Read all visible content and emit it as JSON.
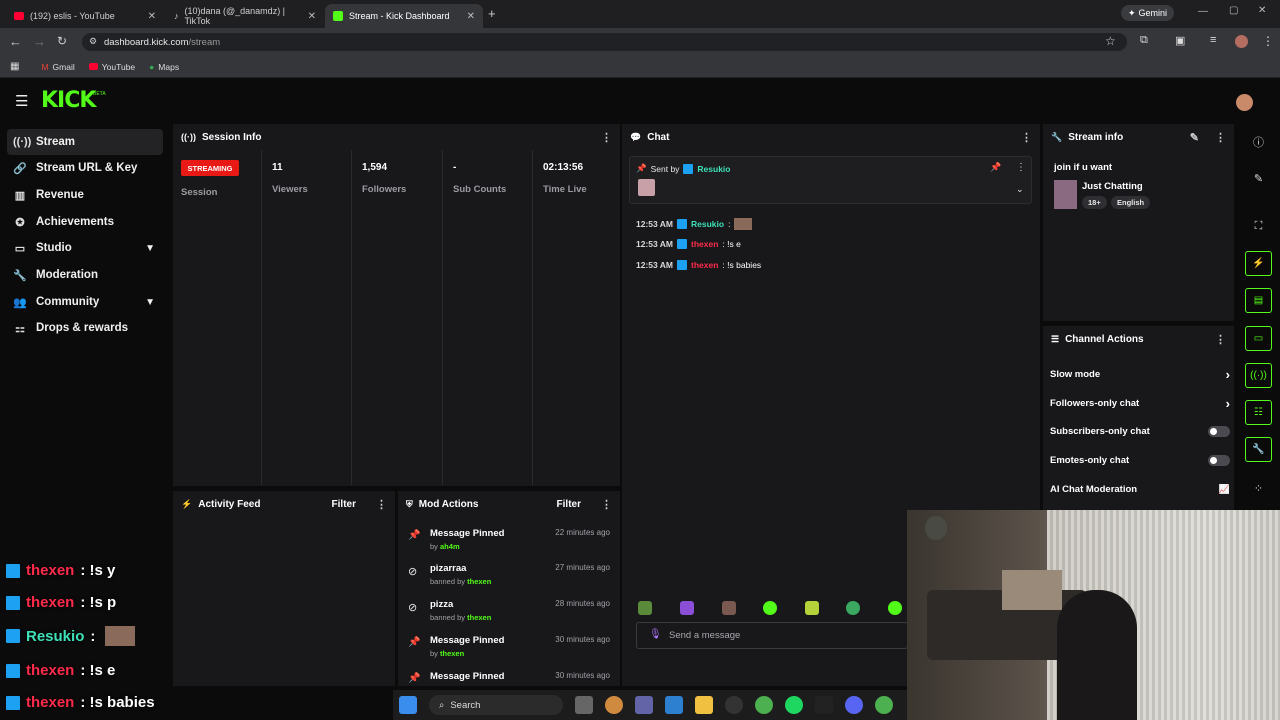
{
  "browser": {
    "tabs": [
      {
        "label": "(192) eslis - YouTube"
      },
      {
        "label": "(10)dana (@_danamdz) | TikTok"
      },
      {
        "label": "Stream - Kick Dashboard"
      }
    ],
    "url_domain": "dashboard.kick.com",
    "url_path": "/stream",
    "gemini_label": "Gemini",
    "bookmarks": [
      "Gmail",
      "YouTube",
      "Maps"
    ]
  },
  "header": {
    "logo": "KICK",
    "beta": "BETA"
  },
  "sidebar": {
    "items": [
      {
        "label": "Stream",
        "icon": "broadcast-icon"
      },
      {
        "label": "Stream URL & Key",
        "icon": "link-icon"
      },
      {
        "label": "Revenue",
        "icon": "revenue-icon"
      },
      {
        "label": "Achievements",
        "icon": "trophy-icon"
      },
      {
        "label": "Studio",
        "icon": "studio-icon"
      },
      {
        "label": "Moderation",
        "icon": "wrench-icon"
      },
      {
        "label": "Community",
        "icon": "community-icon"
      },
      {
        "label": "Drops & rewards",
        "icon": "drops-icon"
      }
    ]
  },
  "session": {
    "title": "Session Info",
    "status": "STREAMING",
    "status_label": "Session",
    "stats": [
      {
        "value": "11",
        "label": "Viewers"
      },
      {
        "value": "1,594",
        "label": "Followers"
      },
      {
        "value": "-",
        "label": "Sub Counts"
      },
      {
        "value": "02:13:56",
        "label": "Time Live"
      }
    ]
  },
  "chat": {
    "title": "Chat",
    "pinned_prefix": "Sent by",
    "pinned_user": "Resukio",
    "messages": [
      {
        "time": "12:53 AM",
        "user": "Resukio",
        "text": ":"
      },
      {
        "time": "12:53 AM",
        "user": "thexen",
        "text": ": !s e"
      },
      {
        "time": "12:53 AM",
        "user": "thexen",
        "text": ": !s babies"
      }
    ],
    "send_placeholder": "Send a message"
  },
  "stream_info": {
    "title": "Stream info",
    "stream_title": "join if u want",
    "category": "Just Chatting",
    "tags": [
      "18+",
      "English"
    ]
  },
  "channel_actions": {
    "title": "Channel Actions",
    "rows": [
      {
        "label": "Slow mode"
      },
      {
        "label": "Followers-only chat"
      },
      {
        "label": "Subscribers-only chat"
      },
      {
        "label": "Emotes-only chat"
      },
      {
        "label": "AI Chat Moderation"
      }
    ]
  },
  "activity": {
    "title": "Activity Feed",
    "filter": "Filter"
  },
  "mod_actions": {
    "title": "Mod Actions",
    "filter": "Filter",
    "rows": [
      {
        "title": "Message Pinned",
        "by": "by",
        "user": "ah4m",
        "time": "22 minutes ago"
      },
      {
        "title": "pizarraa",
        "by": "banned by",
        "user": "thexen",
        "time": "27 minutes ago"
      },
      {
        "title": "pizza",
        "by": "banned by",
        "user": "thexen",
        "time": "28 minutes ago"
      },
      {
        "title": "Message Pinned",
        "by": "by",
        "user": "thexen",
        "time": "30 minutes ago"
      },
      {
        "title": "Message Pinned",
        "by": "",
        "user": "",
        "time": "30 minutes ago"
      }
    ]
  },
  "overlay_chat": [
    {
      "user": "thexen",
      "text": ": !s y"
    },
    {
      "user": "thexen",
      "text": ": !s p"
    },
    {
      "user": "Resukio",
      "text": ":"
    },
    {
      "user": "thexen",
      "text": ": !s e"
    },
    {
      "user": "thexen",
      "text": ": !s babies"
    }
  ],
  "taskbar": {
    "search": "Search"
  }
}
